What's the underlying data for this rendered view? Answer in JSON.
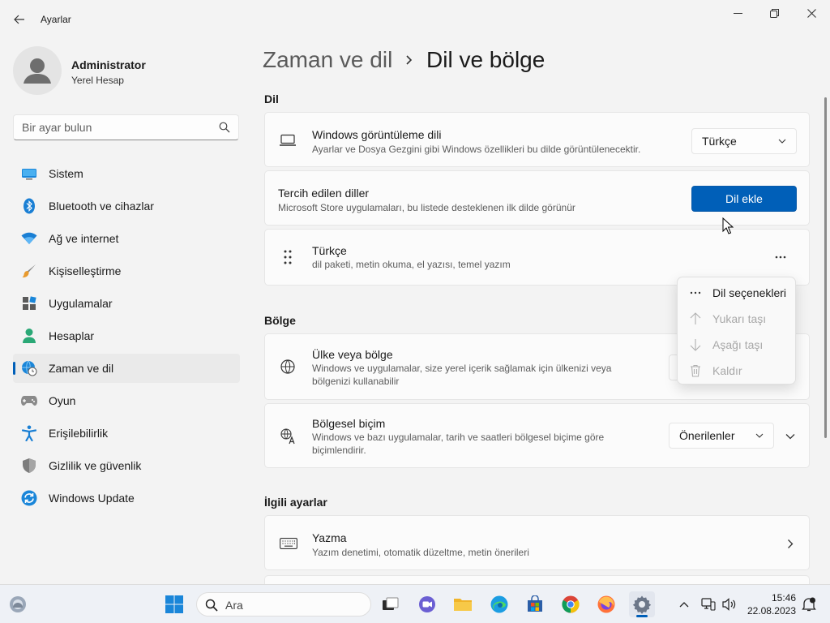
{
  "app": {
    "title": "Ayarlar"
  },
  "profile": {
    "name": "Administrator",
    "account_type": "Yerel Hesap"
  },
  "search": {
    "placeholder": "Bir ayar bulun"
  },
  "nav": {
    "items": [
      {
        "label": "Sistem",
        "icon": "monitor-icon"
      },
      {
        "label": "Bluetooth ve cihazlar",
        "icon": "bluetooth-icon"
      },
      {
        "label": "Ağ ve internet",
        "icon": "wifi-icon"
      },
      {
        "label": "Kişiselleştirme",
        "icon": "brush-icon"
      },
      {
        "label": "Uygulamalar",
        "icon": "apps-icon"
      },
      {
        "label": "Hesaplar",
        "icon": "person-icon"
      },
      {
        "label": "Zaman ve dil",
        "icon": "globe-clock-icon",
        "active": true
      },
      {
        "label": "Oyun",
        "icon": "gamepad-icon"
      },
      {
        "label": "Erişilebilirlik",
        "icon": "accessibility-icon"
      },
      {
        "label": "Gizlilik ve güvenlik",
        "icon": "shield-icon"
      },
      {
        "label": "Windows Update",
        "icon": "update-icon"
      }
    ]
  },
  "breadcrumb": {
    "parent": "Zaman ve dil",
    "current": "Dil ve bölge"
  },
  "sections": {
    "language": {
      "heading": "Dil",
      "display_language": {
        "title": "Windows görüntüleme dili",
        "subtitle": "Ayarlar ve Dosya Gezgini gibi Windows özellikleri bu dilde görüntülenecektir.",
        "value": "Türkçe"
      },
      "preferred": {
        "title": "Tercih edilen diller",
        "subtitle": "Microsoft Store uygulamaları, bu listede desteklenen ilk dilde görünür",
        "button": "Dil ekle"
      },
      "turkish": {
        "title": "Türkçe",
        "subtitle": "dil paketi, metin okuma, el yazısı, temel yazım",
        "more": "···"
      }
    },
    "region": {
      "heading": "Bölge",
      "country": {
        "title": "Ülke veya bölge",
        "subtitle_line1": "Windows ve uygulamalar, size yerel içerik sağlamak için ülkenizi veya",
        "subtitle_line2": "bölgenizi kullanabilir"
      },
      "format": {
        "title": "Bölgesel biçim",
        "subtitle_line1": "Windows ve bazı uygulamalar, tarih ve saatleri bölgesel biçime göre",
        "subtitle_line2": "biçimlendirir.",
        "value": "Önerilenler"
      }
    },
    "related": {
      "heading": "İlgili ayarlar",
      "typing": {
        "title": "Yazma",
        "subtitle": "Yazım denetimi, otomatik düzeltme, metin önerileri"
      }
    }
  },
  "context_menu": {
    "items": [
      {
        "label": "Dil seçenekleri",
        "icon": "more-icon",
        "enabled": true
      },
      {
        "label": "Yukarı taşı",
        "icon": "arrow-up-icon",
        "enabled": false
      },
      {
        "label": "Aşağı taşı",
        "icon": "arrow-down-icon",
        "enabled": false
      },
      {
        "label": "Kaldır",
        "icon": "trash-icon",
        "enabled": false
      }
    ]
  },
  "taskbar": {
    "search_label": "Ara",
    "time": "15:46",
    "date": "22.08.2023",
    "accent": "#005fb8"
  }
}
